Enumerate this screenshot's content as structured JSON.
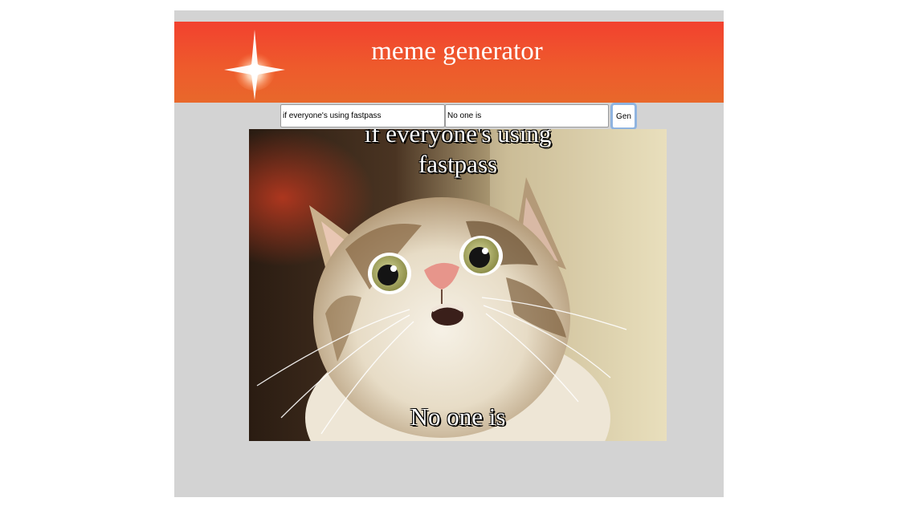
{
  "header": {
    "title": "meme generator",
    "logo_icon": "sparkle-icon"
  },
  "form": {
    "top_text_value": "if everyone's using fastpass",
    "bottom_text_value": "No one is",
    "generate_label": "Gen"
  },
  "meme": {
    "image_subject": "surprised-cat",
    "top_caption": "if everyone's using fastpass",
    "bottom_caption": "No one is"
  },
  "colors": {
    "header_red": "#f2412f",
    "header_orange": "#e8682b",
    "app_background": "#d3d3d3",
    "button_focus": "#8fb4e0"
  }
}
